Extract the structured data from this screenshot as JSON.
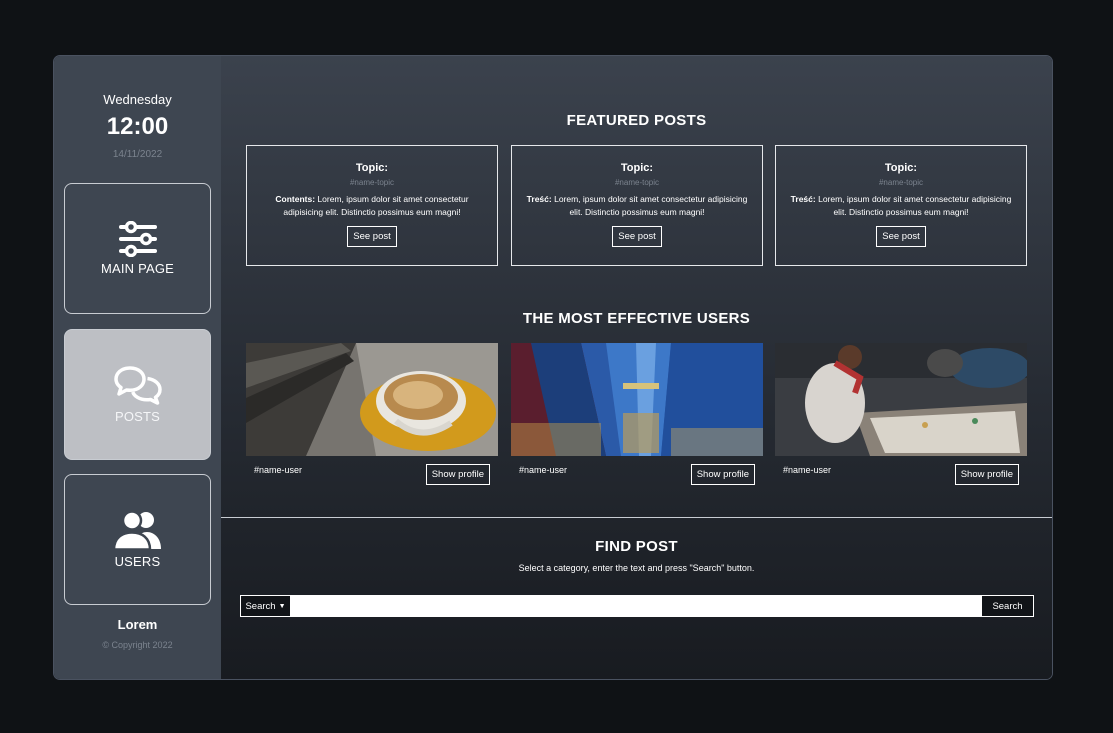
{
  "sidebar": {
    "day": "Wednesday",
    "time": "12:00",
    "date": "14/11/2022",
    "nav": [
      {
        "label": "MAIN PAGE",
        "icon": "sliders-icon",
        "active": false
      },
      {
        "label": "POSTS",
        "icon": "chat-bubbles-icon",
        "active": true
      },
      {
        "label": "USERS",
        "icon": "users-icon",
        "active": false
      }
    ],
    "brand": "Lorem",
    "copyright": "© Copyright 2022"
  },
  "featured": {
    "title": "FEATURED POSTS",
    "posts": [
      {
        "topic": "Topic:",
        "tag": "#name-topic",
        "content_label": "Contents:",
        "content": "Lorem, ipsum dolor sit amet consectetur adipisicing elit. Distinctio possimus eum magni!",
        "button": "See post"
      },
      {
        "topic": "Topic:",
        "tag": "#name-topic",
        "content_label": "Treść:",
        "content": "Lorem, ipsum dolor sit amet consectetur adipisicing elit. Distinctio possimus eum magni!",
        "button": "See post"
      },
      {
        "topic": "Topic:",
        "tag": "#name-topic",
        "content_label": "Treść:",
        "content": "Lorem, ipsum dolor sit amet consectetur adipisicing elit. Distinctio possimus eum magni!",
        "button": "See post"
      }
    ]
  },
  "users": {
    "title": "THE MOST EFFECTIVE USERS",
    "items": [
      {
        "name": "#name-user",
        "button": "Show profile",
        "image": "coffee-cup-photo"
      },
      {
        "name": "#name-user",
        "button": "Show profile",
        "image": "skyscrapers-photo"
      },
      {
        "name": "#name-user",
        "button": "Show profile",
        "image": "team-meeting-photo"
      }
    ]
  },
  "find": {
    "title": "FIND POST",
    "subtitle": "Select a category, enter the text and press \"Search\" button.",
    "dropdown_label": "Search",
    "input_value": "",
    "button": "Search"
  },
  "colors": {
    "page_bg": "#0f1215",
    "sidebar_bg": "#3e4651",
    "active_card": "#bdbfc4",
    "muted_text": "#7b838e"
  }
}
